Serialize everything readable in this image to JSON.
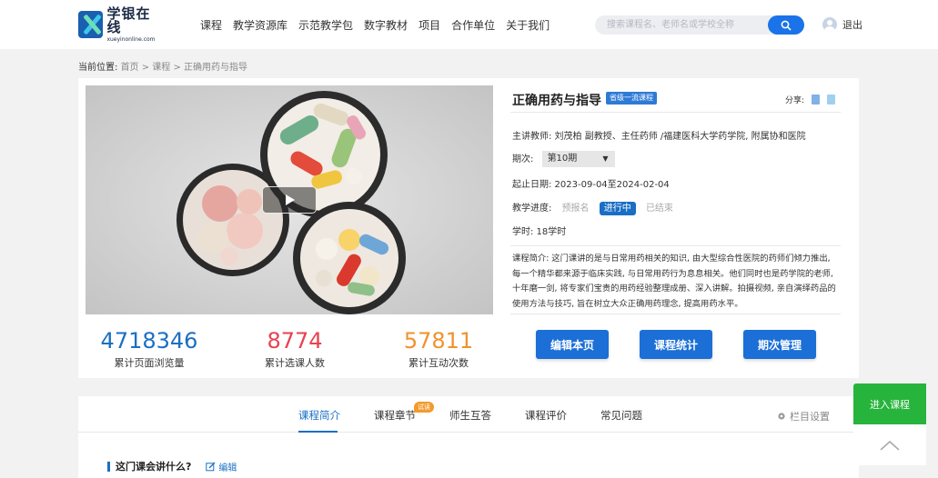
{
  "header": {
    "logo_cn": "学银在线",
    "logo_en": "xueyinonline.com",
    "nav": [
      "课程",
      "教学资源库",
      "示范教学包",
      "数字教材",
      "项目",
      "合作单位",
      "关于我们"
    ],
    "search_placeholder": "搜索课程名、老师名或学校全称",
    "logout": "退出"
  },
  "breadcrumb": {
    "label": "当前位置:",
    "path": "首页 > 课程 > 正确用药与指导"
  },
  "course": {
    "title": "正确用药与指导",
    "badge": "省级一流课程",
    "share_label": "分享:",
    "teacher": "主讲教师: 刘茂柏 副教授、主任药师 /福建医科大学药学院, 附属协和医院",
    "period_label": "期次:",
    "period_value": "第10期",
    "dates": "起止日期: 2023-09-04至2024-02-04",
    "progress_label": "教学进度:",
    "progress_states": [
      "预报名",
      "进行中",
      "已结束"
    ],
    "hours": "学时: 18学时",
    "intro": "课程简介: 这门课讲的是与日常用药相关的知识, 由大型综合性医院的药师们倾力推出, 每一个精华都来源于临床实践, 与日常用药行为息息相关。他们同时也是药学院的老师, 十年磨一剑, 将专家们宝贵的用药经验整理成册、深入讲解。拍摄视频, 亲自演绎药品的使用方法与技巧, 旨在树立大众正确用药理念, 提高用药水平。"
  },
  "stats": [
    {
      "value": "4718346",
      "label": "累计页面浏览量",
      "color": "#1a6fc4"
    },
    {
      "value": "8774",
      "label": "累计选课人数",
      "color": "#e8424f"
    },
    {
      "value": "57811",
      "label": "累计互动次数",
      "color": "#f0922f"
    }
  ],
  "actions": [
    "编辑本页",
    "课程统计",
    "期次管理"
  ],
  "tabs": {
    "items": [
      "课程简介",
      "课程章节",
      "师生互答",
      "课程评价",
      "常见问题"
    ],
    "trial_badge": "试读",
    "column_setting": "栏目设置"
  },
  "section": {
    "title": "这门课会讲什么?",
    "edit": "编辑"
  },
  "float": {
    "enter_course": "进入课程"
  },
  "colors": {
    "accent": "#1a6fc4",
    "green": "#27b43c",
    "orange": "#f29a2e"
  }
}
